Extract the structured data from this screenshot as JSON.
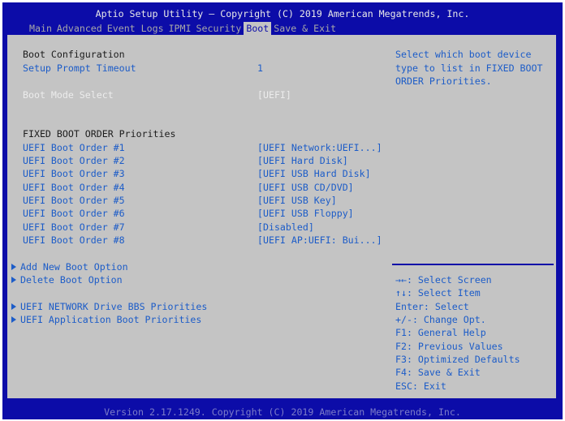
{
  "header": {
    "title": "Aptio Setup Utility – Copyright (C) 2019 American Megatrends, Inc."
  },
  "menu": {
    "tabs": [
      {
        "label": "Main",
        "active": false
      },
      {
        "label": "Advanced",
        "active": false
      },
      {
        "label": "Event Logs",
        "active": false
      },
      {
        "label": "IPMI",
        "active": false
      },
      {
        "label": "Security",
        "active": false
      },
      {
        "label": "Boot",
        "active": true
      },
      {
        "label": "Save & Exit",
        "active": false
      }
    ]
  },
  "settings": {
    "section_boot_config": "Boot Configuration",
    "setup_prompt_timeout": {
      "label": "Setup Prompt Timeout",
      "value": "1"
    },
    "boot_mode_select": {
      "label": "Boot Mode Select",
      "value": "[UEFI]"
    },
    "section_fixed": "FIXED BOOT ORDER Priorities",
    "boot_orders": [
      {
        "label": "UEFI Boot Order #1",
        "value": "[UEFI Network:UEFI...]"
      },
      {
        "label": "UEFI Boot Order #2",
        "value": "[UEFI Hard Disk]"
      },
      {
        "label": "UEFI Boot Order #3",
        "value": "[UEFI USB Hard Disk]"
      },
      {
        "label": "UEFI Boot Order #4",
        "value": "[UEFI USB CD/DVD]"
      },
      {
        "label": "UEFI Boot Order #5",
        "value": "[UEFI USB Key]"
      },
      {
        "label": "UEFI Boot Order #6",
        "value": "[UEFI USB Floppy]"
      },
      {
        "label": "UEFI Boot Order #7",
        "value": "[Disabled]"
      },
      {
        "label": "UEFI Boot Order #8",
        "value": "[UEFI AP:UEFI: Bui...]"
      }
    ],
    "submenus": [
      {
        "label": "Add New Boot Option"
      },
      {
        "label": "Delete Boot Option"
      },
      {
        "label": "UEFI NETWORK Drive BBS Priorities"
      },
      {
        "label": "UEFI Application Boot Priorities"
      }
    ]
  },
  "help": {
    "description": [
      "Select which boot device",
      "type to list in FIXED BOOT",
      "ORDER Priorities."
    ],
    "keys": [
      "→←: Select Screen",
      "↑↓: Select Item",
      "Enter: Select",
      "+/-: Change Opt.",
      "F1: General Help",
      "F2: Previous Values",
      "F3: Optimized Defaults",
      "F4: Save & Exit",
      "ESC: Exit"
    ]
  },
  "footer": {
    "text": "Version 2.17.1249. Copyright (C) 2019 American Megatrends, Inc."
  }
}
